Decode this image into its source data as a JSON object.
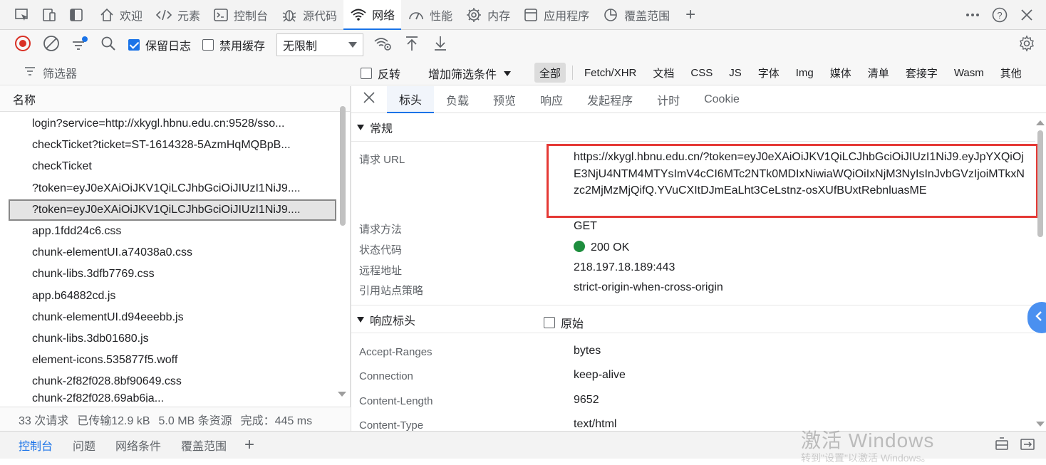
{
  "tabs": [
    {
      "label": "欢迎",
      "icon": "home-icon"
    },
    {
      "label": "元素",
      "icon": "code-icon"
    },
    {
      "label": "控制台",
      "icon": "console-icon"
    },
    {
      "label": "源代码",
      "icon": "bug-icon"
    },
    {
      "label": "网络",
      "icon": "wifi-icon",
      "active": true
    },
    {
      "label": "性能",
      "icon": "gauge-icon"
    },
    {
      "label": "内存",
      "icon": "chip-icon"
    },
    {
      "label": "应用程序",
      "icon": "app-window-icon"
    },
    {
      "label": "覆盖范围",
      "icon": "pie-chart-icon"
    }
  ],
  "toolbar": {
    "preserve_log": "保留日志",
    "preserve_log_checked": true,
    "disable_cache": "禁用缓存",
    "disable_cache_checked": false,
    "throttle": "无限制"
  },
  "filter": {
    "placeholder": "筛选器",
    "invert": "反转",
    "add_filter": "增加筛选条件",
    "types": [
      "全部",
      "Fetch/XHR",
      "文档",
      "CSS",
      "JS",
      "字体",
      "Img",
      "媒体",
      "清单",
      "套接字",
      "Wasm",
      "其他"
    ]
  },
  "request_list": {
    "header": "名称",
    "items": [
      "login?service=http://xkygl.hbnu.edu.cn:9528/sso...",
      "checkTicket?ticket=ST-1614328-5AzmHqMQBpB...",
      "checkTicket",
      "?token=eyJ0eXAiOiJKV1QiLCJhbGciOiJIUzI1NiJ9....",
      "?token=eyJ0eXAiOiJKV1QiLCJhbGciOiJIUzI1NiJ9....",
      "app.1fdd24c6.css",
      "chunk-elementUI.a74038a0.css",
      "chunk-libs.3dfb7769.css",
      "app.b64882cd.js",
      "chunk-elementUI.d94eeebb.js",
      "chunk-libs.3db01680.js",
      "element-icons.535877f5.woff",
      "chunk-2f82f028.8bf90649.css",
      "chunk-2f82f028.69ab6ja..."
    ],
    "selected_index": 4
  },
  "status": {
    "requests": "33 次请求",
    "transferred": "已传输12.9 kB",
    "resources": "5.0 MB 条资源",
    "finish": "完成：445 ms"
  },
  "detail_tabs": [
    "标头",
    "负载",
    "预览",
    "响应",
    "发起程序",
    "计时",
    "Cookie"
  ],
  "general": {
    "title": "常规",
    "url_label": "请求 URL",
    "url": "https://xkygl.hbnu.edu.cn/?token=eyJ0eXAiOiJKV1QiLCJhbGciOiJIUzI1NiJ9.eyJpYXQiOjE3NjU4NTM4MTYsImV4cCI6MTc2NTk0MDIxNiwiaWQiOiIxNjM3NyIsInJvbGVzIjoiMTkxNzc2MjMzMjQifQ.YVuCXItDJmEaLht3CeLstnz-osXUfBUxtRebnluasME",
    "method_label": "请求方法",
    "method": "GET",
    "status_label": "状态代码",
    "status_code": "200 OK",
    "remote_label": "远程地址",
    "remote": "218.197.18.189:443",
    "referrer_label": "引用站点策略",
    "referrer": "strict-origin-when-cross-origin"
  },
  "response_headers": {
    "title": "响应标头",
    "raw": "原始",
    "rows": [
      {
        "name": "Accept-Ranges",
        "value": "bytes"
      },
      {
        "name": "Connection",
        "value": "keep-alive"
      },
      {
        "name": "Content-Length",
        "value": "9652"
      },
      {
        "name": "Content-Type",
        "value": "text/html"
      }
    ]
  },
  "drawer": {
    "tabs": [
      "控制台",
      "问题",
      "网络条件",
      "覆盖范围"
    ]
  },
  "watermark": {
    "title": "激活 Windows",
    "sub": "转到\"设置\"以激活 Windows。"
  },
  "colors": {
    "accent": "#1a73e8",
    "highlight_box": "#e53935",
    "status_ok": "#1e8e3e",
    "record": "#d93025"
  }
}
